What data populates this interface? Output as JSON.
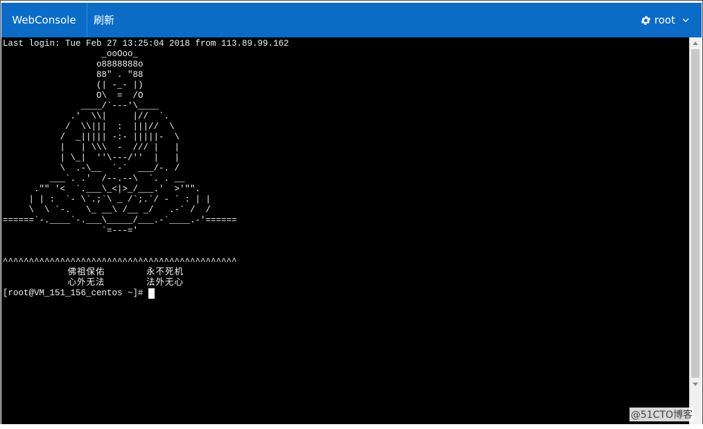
{
  "header": {
    "brand": "WebConsole",
    "refresh_label": "刷新",
    "user_label": "root",
    "bg_color": "#0a6cc6"
  },
  "terminal": {
    "lines": [
      "Last login: Tue Feb 27 13:25:04 2018 from 113.89.99.162",
      "                   _ooOoo_",
      "                  o8888888o",
      "                  88\" . \"88",
      "                  (| -_- |)",
      "                  O\\  =  /O",
      "               ____/`---'\\____",
      "             .'  \\\\|     |//  `.",
      "            /  \\\\|||  :  |||//  \\",
      "           /  _||||| -:- |||||-  \\",
      "           |   | \\\\\\  -  /// |   |",
      "           | \\_|  ''\\---/''  |   |",
      "           \\  .-\\__  `-`  ___/-. /",
      "         ___`. .'  /--.--\\  `. . __",
      "      .\"\" '<  `.___\\_<|>_/___.'  >'\"\".",
      "     | | :  `- \\`.;`\\ _ /`;.`/ - ` : | |",
      "     \\  \\ `-.   \\_ __\\ /__ _/   .-` /  /",
      "======`-.____`-.___\\_____/___.-`____.-'======",
      "                   `=---='",
      "",
      "",
      "^^^^^^^^^^^^^^^^^^^^^^^^^^^^^^^^^^^^^^^^^^^^^",
      "           佛祖保佑       永不死机",
      "           心外无法       法外无心"
    ],
    "prompt": "[root@VM_151_156_centos ~]# "
  },
  "watermark": "@51CTO博客"
}
